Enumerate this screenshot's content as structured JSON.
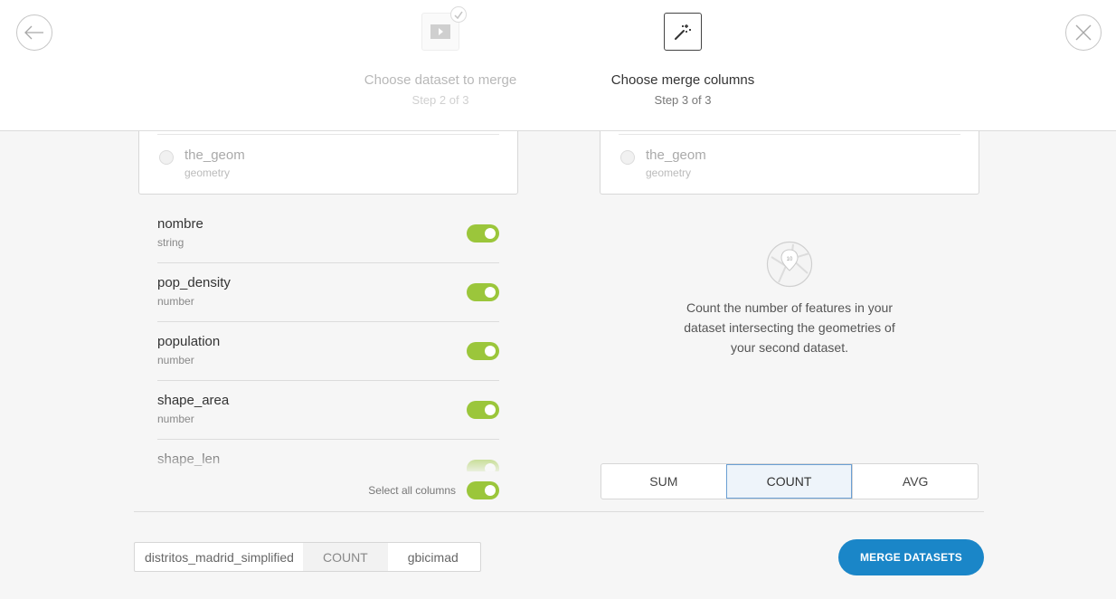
{
  "header": {
    "steps": [
      {
        "title": "Choose dataset to merge",
        "subtitle": "Step 2 of 3",
        "icon": "play-video-icon",
        "completed": true
      },
      {
        "title": "Choose merge columns",
        "subtitle": "Step 3 of 3",
        "icon": "magic-wand-icon",
        "completed": false
      }
    ],
    "back_icon": "arrow-left-icon",
    "close_icon": "close-icon"
  },
  "left_dataset": {
    "geometry_column": {
      "name": "the_geom",
      "type": "geometry"
    },
    "columns": [
      {
        "name": "nombre",
        "type": "string",
        "enabled": true
      },
      {
        "name": "pop_density",
        "type": "number",
        "enabled": true
      },
      {
        "name": "population",
        "type": "number",
        "enabled": true
      },
      {
        "name": "shape_area",
        "type": "number",
        "enabled": true
      },
      {
        "name": "shape_len",
        "type": "",
        "enabled": true
      }
    ],
    "select_all_label": "Select all columns",
    "select_all_enabled": true
  },
  "right_dataset": {
    "geometry_column": {
      "name": "the_geom",
      "type": "geometry"
    },
    "illustration_icon": "map-pin-count-icon",
    "illustration_number": "10",
    "description": "Count the number of features in your dataset intersecting the geometries of your second dataset.",
    "operations": [
      {
        "label": "SUM",
        "active": false
      },
      {
        "label": "COUNT",
        "active": true
      },
      {
        "label": "AVG",
        "active": false
      }
    ]
  },
  "footer": {
    "breadcrumb": [
      "distritos_madrid_simplified",
      "COUNT",
      "gbicimad"
    ],
    "merge_button": "MERGE DATASETS"
  },
  "colors": {
    "toggle_on": "#9bc63b",
    "primary_button": "#1a86c8",
    "active_segment_border": "#6a9fd3"
  }
}
